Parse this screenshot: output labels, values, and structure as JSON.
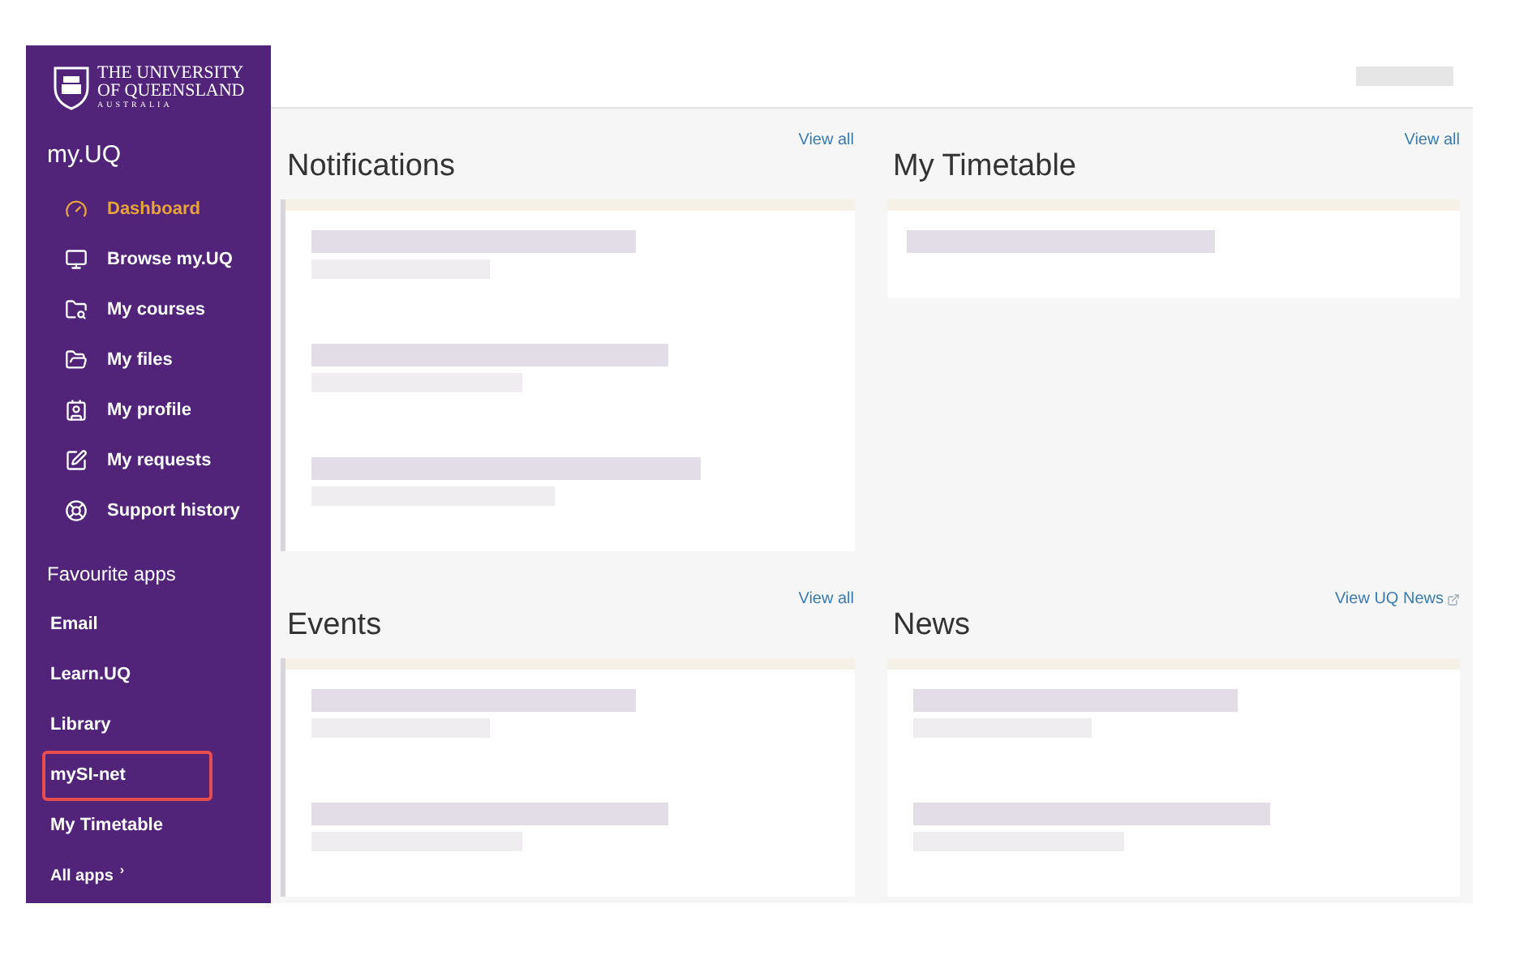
{
  "brand": {
    "lines": [
      "THE UNIVERSITY",
      "OF QUEENSLAND",
      "AUSTRALIA"
    ]
  },
  "sidebar": {
    "title": "my.UQ",
    "items": [
      {
        "label": "Dashboard",
        "selected": true
      },
      {
        "label": "Browse my.UQ",
        "selected": false
      },
      {
        "label": "My courses",
        "selected": false
      },
      {
        "label": "My files",
        "selected": false
      },
      {
        "label": "My profile",
        "selected": false
      },
      {
        "label": "My requests",
        "selected": false
      },
      {
        "label": "Support history",
        "selected": false
      }
    ],
    "favourites_title": "Favourite apps",
    "favourites": [
      {
        "label": "Email",
        "highlighted": false
      },
      {
        "label": "Learn.UQ",
        "highlighted": false
      },
      {
        "label": "Library",
        "highlighted": false
      },
      {
        "label": "mySI-net",
        "highlighted": true
      },
      {
        "label": "My Timetable",
        "highlighted": false
      }
    ],
    "all_apps": {
      "label": "All apps",
      "chevron": "›"
    }
  },
  "panels": [
    {
      "title": "Notifications",
      "link": "View all",
      "external": false
    },
    {
      "title": "My Timetable",
      "link": "View all",
      "external": false
    },
    {
      "title": "Events",
      "link": "View all",
      "external": false
    },
    {
      "title": "News",
      "link": "View UQ News",
      "external": true
    }
  ]
}
